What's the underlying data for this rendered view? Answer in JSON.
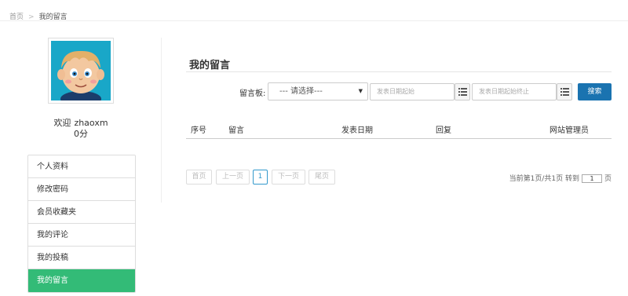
{
  "breadcrumb": {
    "home": "首页",
    "sep": ">",
    "current": "我的留言"
  },
  "user": {
    "welcome": "欢迎",
    "name": "zhaoxm",
    "points": "0分"
  },
  "menu": {
    "items": [
      {
        "label": "个人资料"
      },
      {
        "label": "修改密码"
      },
      {
        "label": "会员收藏夹"
      },
      {
        "label": "我的评论"
      },
      {
        "label": "我的投稿"
      },
      {
        "label": "我的留言"
      }
    ],
    "active_color": "#33bb77"
  },
  "section": {
    "title": "我的留言"
  },
  "filter": {
    "label": "留言板:",
    "select_value": "--- 请选择---",
    "start_placeholder": "发表日期起始",
    "end_placeholder": "发表日期起始终止",
    "search_label": "搜索",
    "search_color": "#1a73b0"
  },
  "table": {
    "headers": [
      "序号",
      "留言",
      "发表日期",
      "回复",
      "网站管理员"
    ]
  },
  "pagination": {
    "first": "首页",
    "prev": "上一页",
    "current": "1",
    "next": "下一页",
    "last": "尾页",
    "info_prefix": "当前第1页/共1页 转到",
    "goto_value": "1",
    "info_suffix": "页"
  }
}
